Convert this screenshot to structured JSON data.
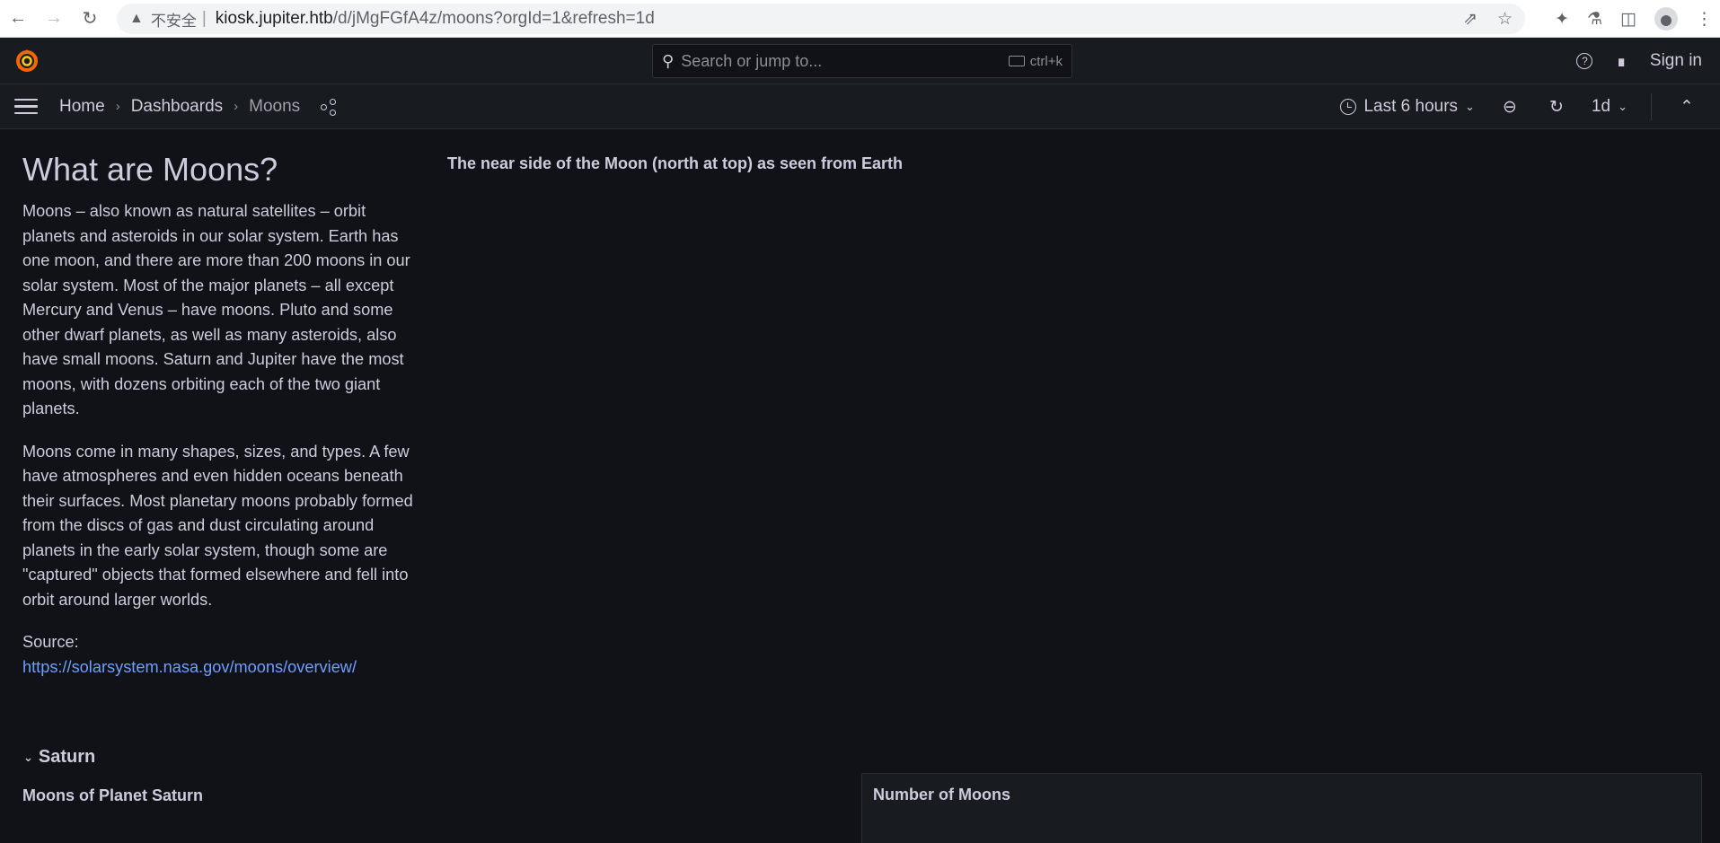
{
  "browser": {
    "insecure_label": "不安全",
    "url_host": "kiosk.jupiter.htb",
    "url_path": "/d/jMgFGfA4z/moons?orgId=1&refresh=1d"
  },
  "topbar": {
    "search_placeholder": "Search or jump to...",
    "search_shortcut": "ctrl+k",
    "sign_in": "Sign in"
  },
  "breadcrumb": {
    "home": "Home",
    "dashboards": "Dashboards",
    "current": "Moons"
  },
  "controls": {
    "time_range": "Last 6 hours",
    "refresh_interval": "1d"
  },
  "text_panel": {
    "heading": "What are Moons?",
    "paragraph1": "Moons – also known as natural satellites – orbit planets and asteroids in our solar system. Earth has one moon, and there are more than 200 moons in our solar system. Most of the major planets – all except Mercury and Venus – have moons. Pluto and some other dwarf planets, as well as many asteroids, also have small moons. Saturn and Jupiter have the most moons, with dozens orbiting each of the two giant planets.",
    "paragraph2": "Moons come in many shapes, sizes, and types. A few have atmospheres and even hidden oceans beneath their surfaces. Most planetary moons probably formed from the discs of gas and dust circulating around planets in the early solar system, though some are \"captured\" objects that formed elsewhere and fell into orbit around larger worlds.",
    "source_label": "Source:",
    "source_link": "https://solarsystem.nasa.gov/moons/overview/"
  },
  "moon_panel": {
    "title": "The near side of the Moon (north at top) as seen from Earth"
  },
  "row": {
    "title": "Saturn"
  },
  "saturn_panel": {
    "title": "Moons of Planet Saturn"
  },
  "number_panel": {
    "title": "Number of Moons"
  }
}
